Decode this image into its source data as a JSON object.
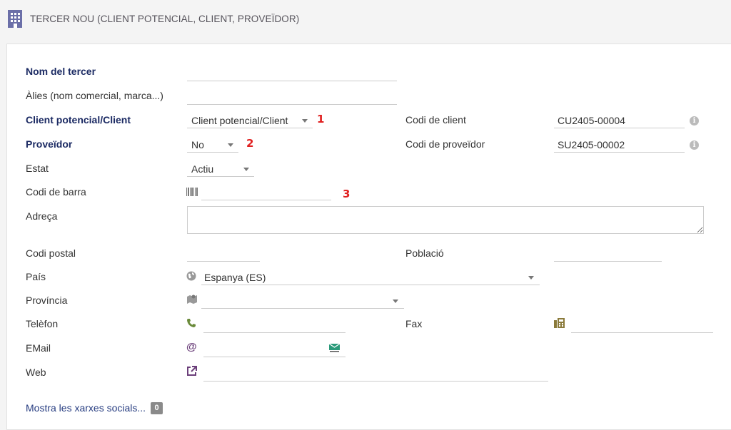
{
  "header": {
    "title": "TERCER NOU (CLIENT POTENCIAL, CLIENT, PROVEÏDOR)",
    "icon": "building-icon"
  },
  "form": {
    "name": {
      "label": "Nom del tercer",
      "value": ""
    },
    "alias": {
      "label": "Àlies (nom comercial, marca...)",
      "value": ""
    },
    "client_type": {
      "label": "Client potencial/Client",
      "value": "Client potencial/Client",
      "marker": "1"
    },
    "supplier": {
      "label": "Proveïdor",
      "value": "No",
      "marker": "2"
    },
    "status": {
      "label": "Estat",
      "value": "Actiu"
    },
    "barcode": {
      "label": "Codi de barra",
      "value": "",
      "marker": "3"
    },
    "address": {
      "label": "Adreça",
      "value": ""
    },
    "zip": {
      "label": "Codi postal",
      "value": ""
    },
    "country": {
      "label": "País",
      "value": "Espanya (ES)"
    },
    "province": {
      "label": "Província",
      "value": ""
    },
    "phone": {
      "label": "Telèfon",
      "value": ""
    },
    "email": {
      "label": "EMail",
      "value": ""
    },
    "web": {
      "label": "Web",
      "value": ""
    },
    "customer_code": {
      "label": "Codi de client",
      "value": "CU2405-00004"
    },
    "supplier_code": {
      "label": "Codi de proveïdor",
      "value": "SU2405-00002"
    },
    "town": {
      "label": "Població",
      "value": ""
    },
    "fax": {
      "label": "Fax",
      "value": ""
    }
  },
  "social": {
    "link_label": "Mostra les xarxes socials...",
    "count": "0"
  },
  "colors": {
    "required_label": "#1b2a63",
    "marker": "#e02020",
    "link": "#263c80"
  }
}
